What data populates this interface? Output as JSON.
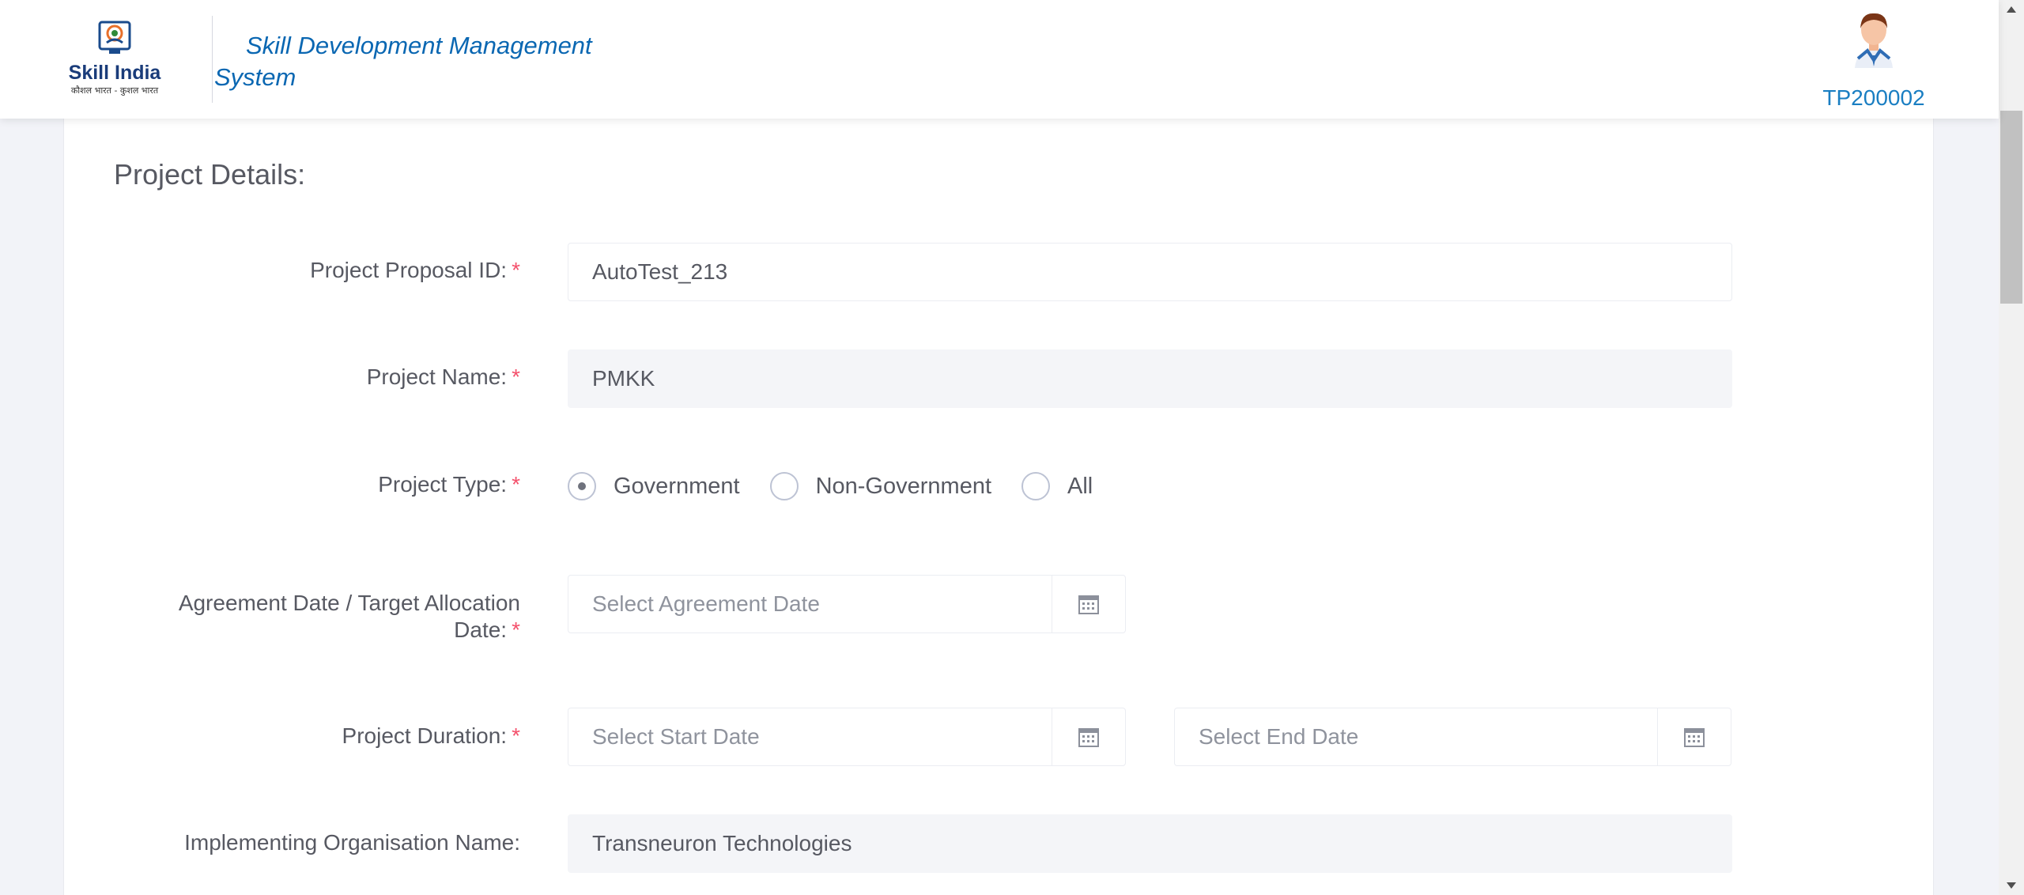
{
  "header": {
    "logo_name": "Skill India",
    "logo_tagline": "कौशल भारत - कुशल भारत",
    "app_title": "Skill Development Management System",
    "user_id": "TP200002"
  },
  "section": {
    "title": "Project Details:"
  },
  "fields": {
    "proposal_id": {
      "label": "Project Proposal ID:",
      "required": "*",
      "value": "AutoTest_213"
    },
    "project_name": {
      "label": "Project Name:",
      "required": "*",
      "value": "PMKK"
    },
    "project_type": {
      "label": "Project Type:",
      "required": "*",
      "options": [
        "Government",
        "Non-Government",
        "All"
      ],
      "selected": "Government"
    },
    "agreement_date": {
      "label_line1": "Agreement Date / Target Allocation",
      "label_line2": "Date:",
      "required": "*",
      "placeholder": "Select Agreement Date"
    },
    "project_duration": {
      "label": "Project Duration:",
      "required": "*",
      "start_placeholder": "Select Start Date",
      "end_placeholder": "Select End Date"
    },
    "implementing_org": {
      "label": "Implementing Organisation Name:",
      "value": "Transneuron Technologies"
    }
  },
  "icons": {
    "calendar": "calendar-icon",
    "user": "user-avatar-icon",
    "logo": "skill-india-logo"
  },
  "colors": {
    "brand_blue": "#0a67b2",
    "required_red": "#f4516c",
    "user_id_blue": "#1a7ec2"
  }
}
